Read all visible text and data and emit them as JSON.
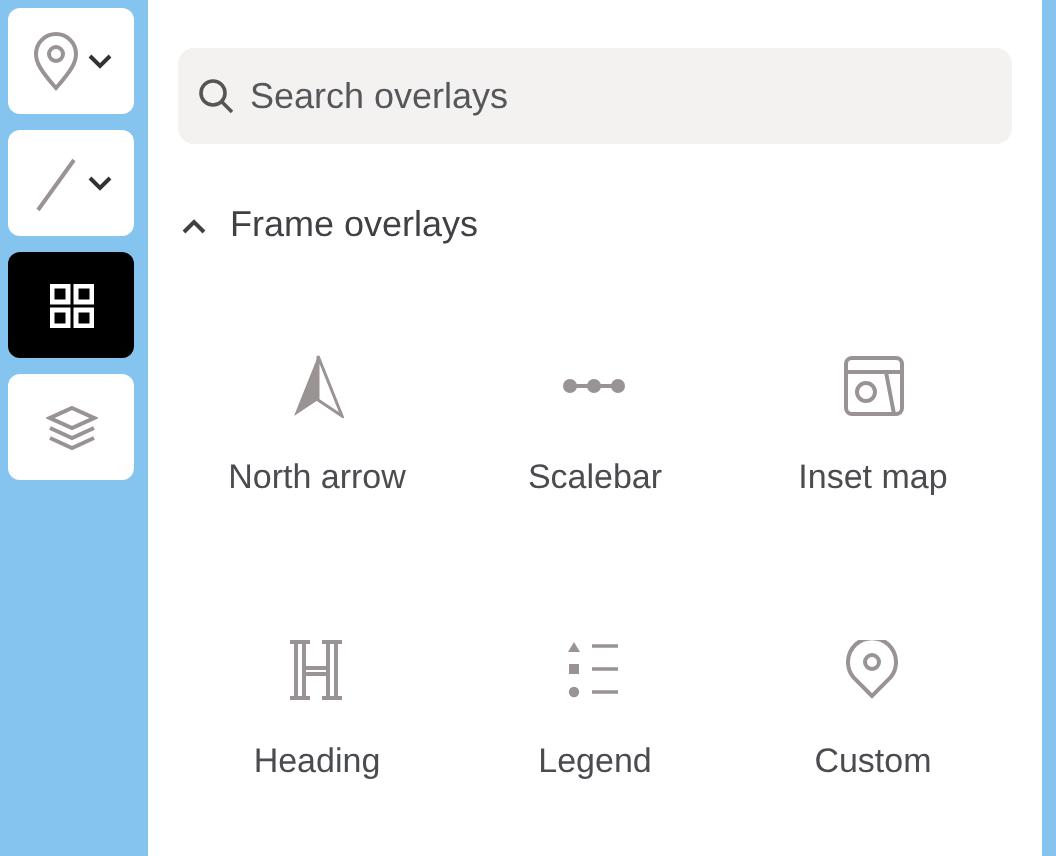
{
  "toolbar": [
    {
      "has_dropdown": true,
      "selected": false
    },
    {
      "has_dropdown": true,
      "selected": false
    },
    {
      "has_dropdown": false,
      "selected": true
    },
    {
      "has_dropdown": false,
      "selected": false
    }
  ],
  "search": {
    "placeholder": "Search overlays"
  },
  "section": {
    "title": "Frame overlays",
    "expanded": true,
    "items": [
      {
        "label": "North arrow"
      },
      {
        "label": "Scalebar"
      },
      {
        "label": "Inset map"
      },
      {
        "label": "Heading"
      },
      {
        "label": "Legend"
      },
      {
        "label": "Custom"
      }
    ]
  }
}
